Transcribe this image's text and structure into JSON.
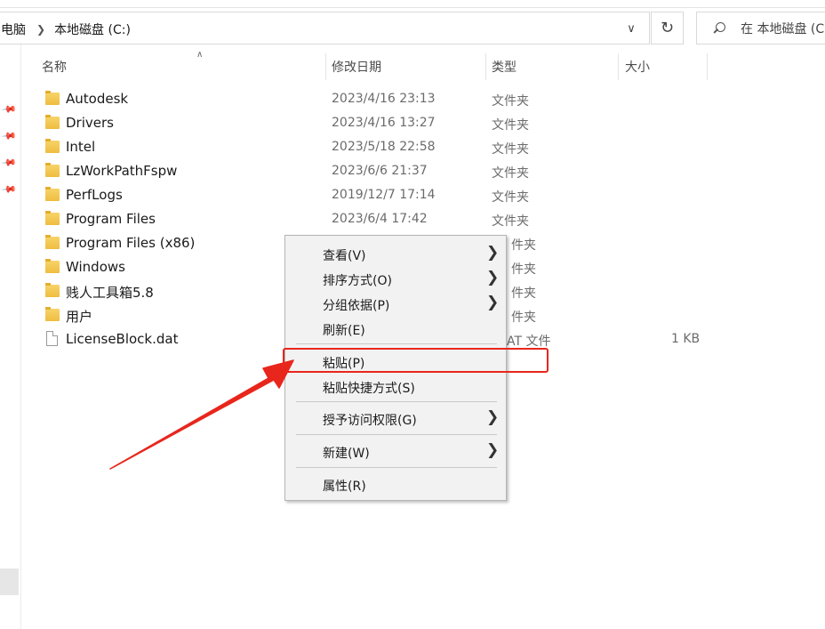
{
  "address": {
    "crumbs": [
      "电脑",
      "本地磁盘 (C:)"
    ]
  },
  "search": {
    "placeholder": "在 本地磁盘 (C"
  },
  "columns": {
    "name": "名称",
    "modified": "修改日期",
    "type": "类型",
    "size": "大小"
  },
  "files": [
    {
      "name": "Autodesk",
      "date": "2023/4/16 23:13",
      "type": "文件夹",
      "size": "",
      "icon": "folder-icon"
    },
    {
      "name": "Drivers",
      "date": "2023/4/16 13:27",
      "type": "文件夹",
      "size": "",
      "icon": "folder-icon"
    },
    {
      "name": "Intel",
      "date": "2023/5/18 22:58",
      "type": "文件夹",
      "size": "",
      "icon": "folder-icon"
    },
    {
      "name": "LzWorkPathFspw",
      "date": "2023/6/6 21:37",
      "type": "文件夹",
      "size": "",
      "icon": "folder-icon"
    },
    {
      "name": "PerfLogs",
      "date": "2019/12/7 17:14",
      "type": "文件夹",
      "size": "",
      "icon": "folder-icon"
    },
    {
      "name": "Program Files",
      "date": "2023/6/4 17:42",
      "type": "文件夹",
      "size": "",
      "icon": "folder-icon"
    },
    {
      "name": "Program Files (x86)",
      "date": "",
      "type": "件夹",
      "size": "",
      "icon": "folder-icon"
    },
    {
      "name": "Windows",
      "date": "",
      "type": "件夹",
      "size": "",
      "icon": "folder-icon"
    },
    {
      "name": "贱人工具箱5.8",
      "date": "",
      "type": "件夹",
      "size": "",
      "icon": "folder-icon"
    },
    {
      "name": "用户",
      "date": "",
      "type": "件夹",
      "size": "",
      "icon": "folder-icon"
    },
    {
      "name": "LicenseBlock.dat",
      "date": "",
      "type": "AT 文件",
      "size": "1 KB",
      "icon": "file-icon"
    }
  ],
  "context_menu": {
    "items": [
      {
        "label": "查看(V)",
        "submenu": true
      },
      {
        "label": "排序方式(O)",
        "submenu": true
      },
      {
        "label": "分组依据(P)",
        "submenu": true
      },
      {
        "label": "刷新(E)",
        "submenu": false
      },
      {
        "label": "粘贴(P)",
        "submenu": false
      },
      {
        "label": "粘贴快捷方式(S)",
        "submenu": false
      },
      {
        "label": "授予访问权限(G)",
        "submenu": true
      },
      {
        "label": "新建(W)",
        "submenu": true
      },
      {
        "label": "属性(R)",
        "submenu": false
      }
    ]
  },
  "annotation": {
    "color": "#e8261c",
    "highlighted_item": "粘贴(P)"
  }
}
